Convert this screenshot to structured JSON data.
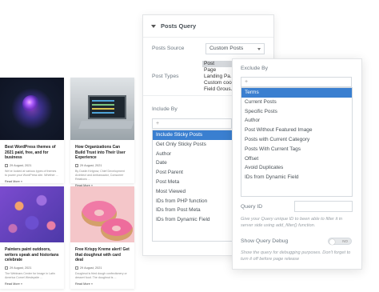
{
  "cards": [
    {
      "title": "Best WordPress themes of 2021 paid, free, and for business",
      "date": "29 August, 2021",
      "excerpt": "We've looked at various types of themes to power your WordPress site. Whether ...",
      "readmore": "Read More »"
    },
    {
      "title": "How Organizations Can Build Trust into Their User Experience",
      "date": "29 August, 2021",
      "excerpt": "By Dustin Kelgrow, Chief Development Architect and Ambassador, Consumer Relations ...",
      "readmore": "Read More »"
    },
    {
      "title": "Painters paint outdoors, writers speak and historians celebrate",
      "date": "29 August, 2021",
      "excerpt": "The Webinars Center for Image in Latin America Cornel Wesleysite ...",
      "readmore": "Read More »"
    },
    {
      "title": "Free Krispy Kreme alert! Get that doughnut with card deal",
      "date": "29 August, 2021",
      "excerpt": "Doughnut is fried dough confectionery or dessert food. The doughnut is ...",
      "readmore": "Read More »"
    }
  ],
  "panel": {
    "title": "Posts Query",
    "posts_source_label": "Posts Source",
    "posts_source_value": "Custom Posts",
    "post_types_label": "Post Types",
    "post_types_options": [
      "Post",
      "Page",
      "Landing Pa...",
      "Custom coo...",
      "Field Grous..."
    ],
    "include_by_label": "Include By",
    "include_by_plus": "+",
    "include_by_options": [
      "Include Sticky Posts",
      "Get Only Sticky Posts",
      "Author",
      "Date",
      "Post Parent",
      "Post Meta",
      "Most Viewed",
      "IDs from PHP function",
      "IDs from Post Meta",
      "IDs from Dynamic Field"
    ]
  },
  "panel2": {
    "exclude_by_label": "Exclude By",
    "exclude_by_plus": "+",
    "exclude_by_options": [
      "Terms",
      "Current Posts",
      "Specific Posts",
      "Author",
      "Post Without Featured Image",
      "Posts with Current Category",
      "Posts With Current Tags",
      "Offset",
      "Avoid Duplicates",
      "IDs from Dynamic Field"
    ],
    "query_id_label": "Query ID",
    "query_id_help": "Give your Query unique ID to been able to filter it in server side using add_filter() function.",
    "query_debug_label": "Show Query Debug",
    "query_debug_toggle": "NO",
    "query_debug_help": "Show the query for debugging purposes. Don't forget to turn it off before page release"
  },
  "colors": {
    "accent": "#3a7fd0",
    "label": "#6d7882"
  }
}
